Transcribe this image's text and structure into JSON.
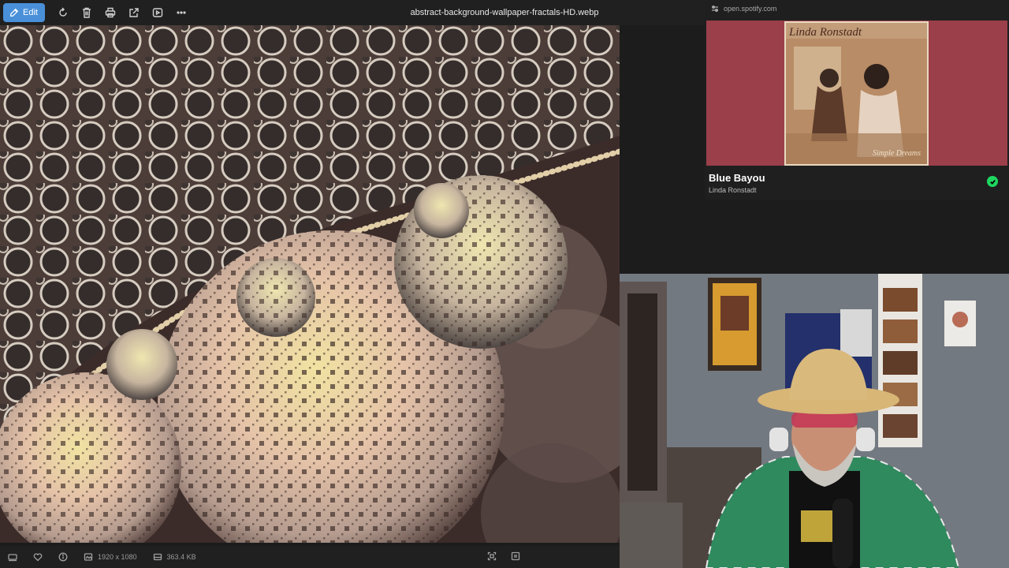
{
  "toolbar": {
    "edit_label": "Edit",
    "file_name": "abstract-background-wallpaper-fractals-HD.webp",
    "icons": [
      "edit-icon",
      "rotate-icon",
      "delete-icon",
      "print-icon",
      "share-icon",
      "slideshow-icon",
      "more-icon"
    ]
  },
  "spotify": {
    "url": "open.spotify.com",
    "album_artist_text": "Linda Ronstadt",
    "album_sub_text": "Simple Dreams",
    "track_title": "Blue Bayou",
    "track_artist": "Linda Ronstadt",
    "accent_color": "#1ed760",
    "background_color": "#9b3f4a"
  },
  "statusbar": {
    "dimensions": "1920 x 1080",
    "file_size": "363.4 KB"
  }
}
